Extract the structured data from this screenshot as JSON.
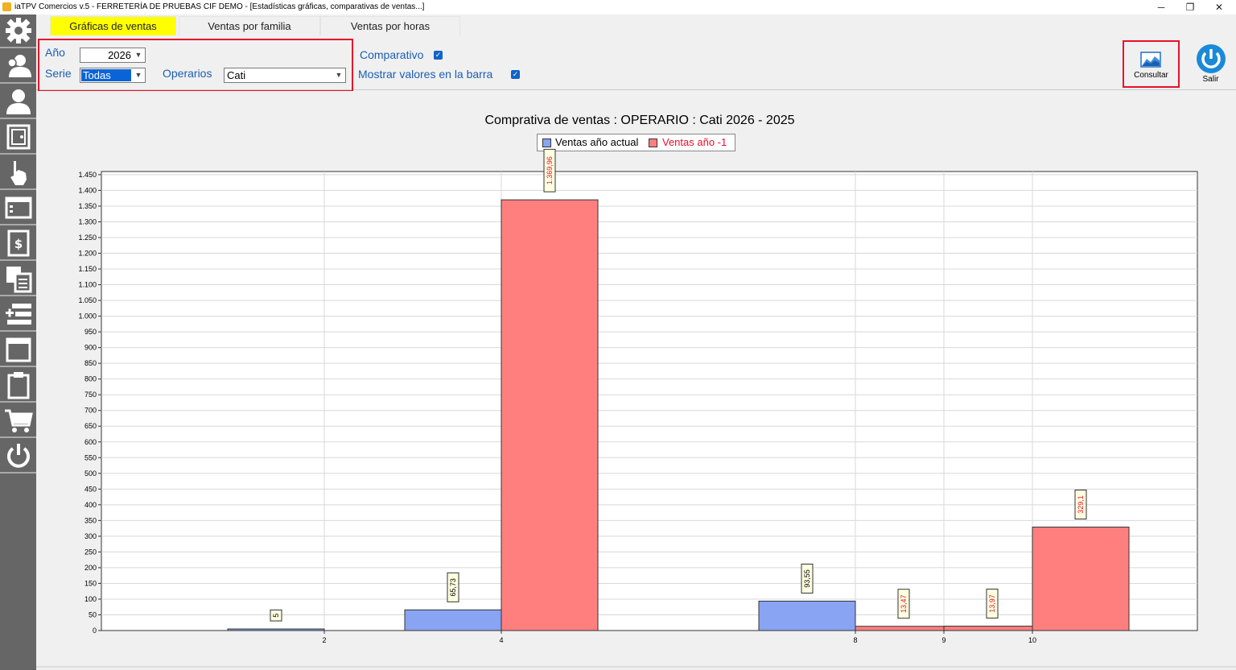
{
  "window": {
    "title": "iaTPV Comercios v.5 - FERRETERÍA DE PRUEBAS CIF DEMO - [Estadísticas gráficas, comparativas de ventas...]",
    "minimize": "─",
    "restore": "❐",
    "close": "✕"
  },
  "tabs": [
    {
      "label": "Gráficas de ventas"
    },
    {
      "label": "Ventas por familia"
    },
    {
      "label": "Ventas por horas"
    }
  ],
  "filters": {
    "anio_label": "Año",
    "anio_value": "2026",
    "serie_label": "Serie",
    "serie_value": "Todas",
    "operarios_label": "Operarios",
    "operarios_value": "Cati",
    "comparativo_label": "Comparativo",
    "comparativo_checked": true,
    "mostrar_label": "Mostrar valores en la barra",
    "mostrar_checked": true
  },
  "actions": {
    "consultar_label": "Consultar",
    "salir_label": "Salir"
  },
  "colors": {
    "current": "#88a4f2",
    "previous": "#ff7f7f",
    "highlight": "#ffff00",
    "accent": "#1a5fb4"
  },
  "chart_data": {
    "type": "bar",
    "title": "Comprativa de ventas :  OPERARIO : Cati 2026 - 2025",
    "xlabel": "",
    "ylabel": "",
    "ylim": [
      0,
      1460
    ],
    "ytick_step": 50,
    "ytick_labels": [
      "0",
      "50",
      "100",
      "150",
      "200",
      "250",
      "300",
      "350",
      "400",
      "450",
      "500",
      "550",
      "600",
      "650",
      "700",
      "750",
      "800",
      "850",
      "900",
      "950",
      "1.000",
      "1.050",
      "1.100",
      "1.150",
      "1.200",
      "1.250",
      "1.300",
      "1.350",
      "1.400",
      "1.450"
    ],
    "categories": [
      "2",
      "4",
      "8",
      "9",
      "10"
    ],
    "grid": true,
    "legend_position": "top-center",
    "series": [
      {
        "name": "Ventas año actual",
        "values": [
          5,
          65.73,
          93.55,
          null,
          null
        ],
        "labels": [
          "5",
          "65,73",
          "93,55",
          "",
          ""
        ]
      },
      {
        "name": "Ventas año -1",
        "values": [
          null,
          1369.96,
          13.47,
          13.97,
          329.1
        ],
        "labels": [
          "",
          "1.369,96",
          "13,47",
          "13,97",
          "329,1"
        ]
      }
    ]
  }
}
